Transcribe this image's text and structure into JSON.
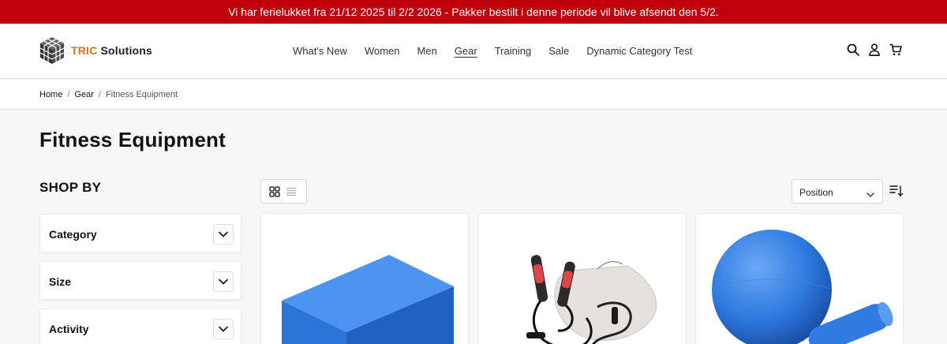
{
  "announcement": "Vi har ferielukket fra 21/12 2025 til 2/2 2026 - Pakker bestilt i denne periode vil blive afsendt den 5/2.",
  "logo": {
    "brand": "TRIC",
    "rest": "Solutions"
  },
  "nav": [
    {
      "label": "What's New"
    },
    {
      "label": "Women"
    },
    {
      "label": "Men"
    },
    {
      "label": "Gear",
      "active": true
    },
    {
      "label": "Training"
    },
    {
      "label": "Sale"
    },
    {
      "label": "Dynamic Category Test"
    }
  ],
  "header_icons": [
    "search-icon",
    "account-icon",
    "cart-icon"
  ],
  "breadcrumb": {
    "home": "Home",
    "gear": "Gear",
    "current": "Fitness Equipment",
    "separator": "/"
  },
  "page_title": "Fitness Equipment",
  "sidebar": {
    "title": "SHOP BY",
    "filters": [
      {
        "label": "Category"
      },
      {
        "label": "Size"
      },
      {
        "label": "Activity"
      }
    ]
  },
  "toolbar": {
    "view_modes": [
      "grid-view-icon",
      "list-view-icon"
    ],
    "sort_selected": "Position"
  },
  "products": [
    {
      "image": "blue yoga block"
    },
    {
      "image": "jump ropes and resistance bands with drawstring bag"
    },
    {
      "image": "blue exercise ball with foam roller"
    }
  ],
  "colors": {
    "announcement_bg": "#c0000b",
    "logo_accent": "#e2711d",
    "product_blue": "#2f7be0"
  }
}
